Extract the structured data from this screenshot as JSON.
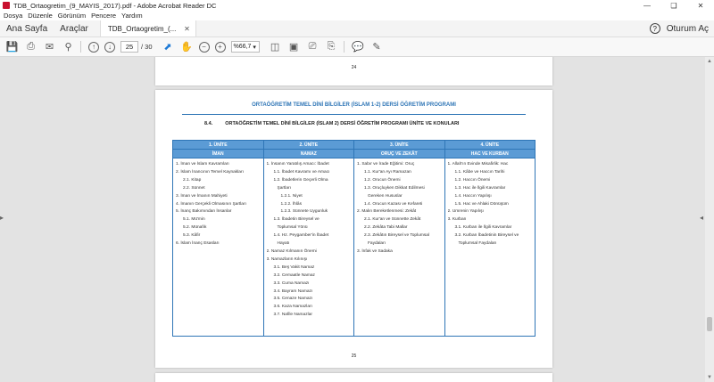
{
  "window": {
    "title": "TDB_Ortaogretim_(9_MAYIS_2017).pdf - Adobe Acrobat Reader DC"
  },
  "menu": [
    "Dosya",
    "Düzenle",
    "Görünüm",
    "Pencere",
    "Yardım"
  ],
  "nav": {
    "home": "Ana Sayfa",
    "tools": "Araçlar",
    "doc_tab": "TDB_Ortaogretim_(...",
    "login": "Oturum Aç"
  },
  "toolbar": {
    "page_current": "25",
    "page_total": "/ 30",
    "zoom": "%66,7"
  },
  "doc": {
    "page1_number": "24",
    "header": "ORTAÖĞRETİM TEMEL DİNİ BİLGİLER (İSLAM 1-2) DERSİ ÖĞRETİM PROGRAMI",
    "section_no": "8.4.",
    "section_title": "ORTAÖĞRETİM TEMEL DİNİ BİLGİLER (İSLAM 2) DERSİ ÖĞRETİM PROGRAMI ÜNİTE VE KONULARI",
    "page2_number": "25",
    "units": [
      {
        "unit": "1. ÜNİTE",
        "name": "İMAN",
        "items": [
          "1.  İman ve İslam Kavramları",
          "2.  İslam İnancının Temel Kaynakları",
          "2.1. Kitap",
          "2.2. Sünnet",
          "3.  İman ve İmanın Mahiyeti",
          "4.  İmanın Gerçekli Olmasının Şartları",
          "5.  İnanç Bakımından İnsanlar",
          "5.1. Mü'min",
          "5.2. Münafık",
          "5.3. Kâfir",
          "6.  İslam İnanç Esasları"
        ]
      },
      {
        "unit": "2. ÜNİTE",
        "name": "NAMAZ",
        "items": [
          "1.  İnsanın Yaratılış Amacı: İbadet",
          "1.1. İbadet Kavramı ve Amacı",
          "1.2. İbadetlerin Geçerli Olma",
          "Şartları",
          "1.2.1.  Niyet",
          "1.2.2.  İhlâs",
          "1.2.3.  Sünnete Uygunluk",
          "1.3. İbadetin Bireysel ve",
          "Toplumsal Yönü",
          "1.4. Hz. Peygamber'in İbadet",
          "Hayatı",
          "2.  Namaz Kılmanın Önemi",
          "3.  Namazların Kılınışı",
          "3.1. Beş Vakit Namaz",
          "3.2. Cemaatle Namaz",
          "3.3. Cuma Namazı",
          "3.4. Bayram Namazı",
          "3.5. Cenaze Namazı",
          "3.6. Kaza Namazları",
          "3.7. Nafile Namazlar"
        ]
      },
      {
        "unit": "3. ÜNİTE",
        "name": "ORUÇ VE ZEKÂT",
        "items": [
          "1.  Sabır ve İrade Eğitimi: Oruç",
          "1.1. Kur'an Ayı Ramazan",
          "1.2. Orucun Önemi",
          "1.3. Oruçluyken Dikkat Edilmesi",
          "Gereken Hususlar",
          "1.4. Orucun Kazası ve Kefareti",
          "2.  Malın Bereketlenmesi: Zekât",
          "2.1. Kur'an ve Sünnette Zekât",
          "2.2. Zekâta Tabi Mallar",
          "2.3. Zekâtın Bireysel ve Toplumsal",
          "Faydaları",
          "3.  İnfak ve Sadaka"
        ]
      },
      {
        "unit": "4. ÜNİTE",
        "name": "HAC VE KURBAN",
        "items": [
          "1.  Allah'ın Evinde Misafirlik: Hac",
          "1.1. Kâbe ve Haccın Tarihi",
          "1.2. Haccın Önemi",
          "1.3. Hac ile İlgili Kavramlar",
          "1.4. Haccın Yapılışı",
          "1.5. Hac ve Ahlaki Dönüşüm",
          "2.  Umrenin Yapılışı",
          "3.  Kurban",
          "3.1. Kurban ile İlgili Kavramlar",
          "3.2. Kurban İbadetinin Bireysel ve",
          "Toplumsal Faydaları"
        ]
      }
    ]
  }
}
